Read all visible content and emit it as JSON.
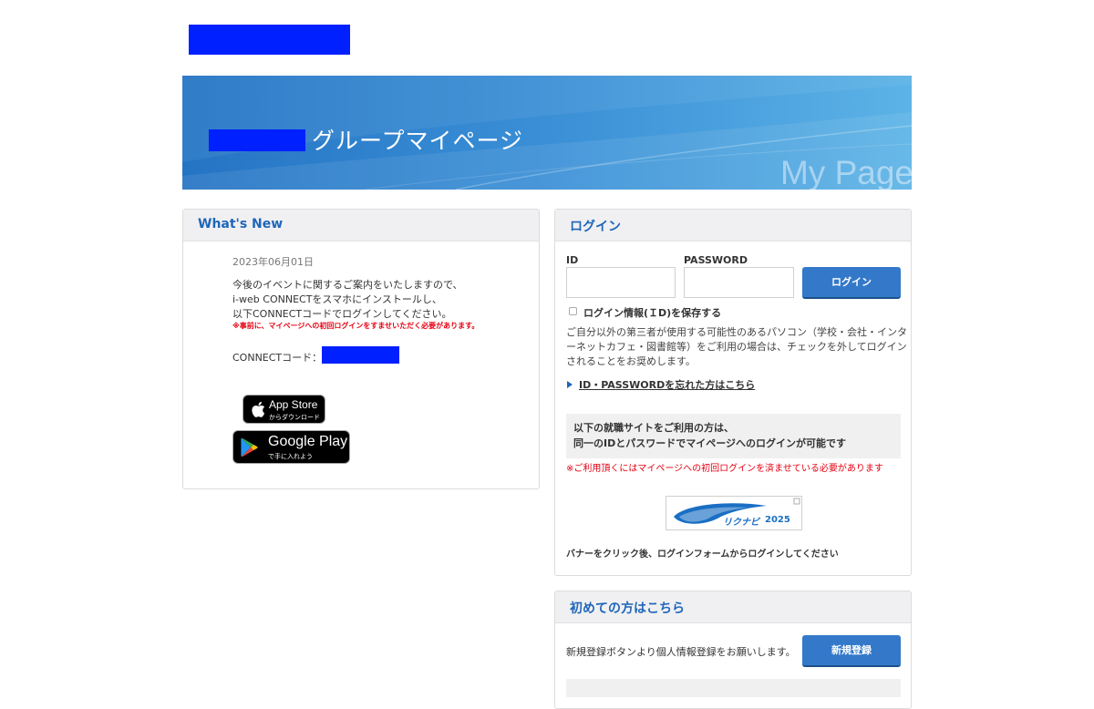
{
  "banner": {
    "title": "グループマイページ",
    "watermark": "My Page"
  },
  "whats_new": {
    "heading": "What's New",
    "date": "2023年06月01日",
    "lines": [
      "今後のイベントに関するご案内をいたしますので、",
      "i-web CONNECTをスマホにインストールし、",
      "以下CONNECTコードでログインしてください。"
    ],
    "warning": "※事前に、マイページへの初回ログインをすませいただく必要があります。",
    "connect_label": "CONNECTコード："
  },
  "app_store": {
    "main": "App Store",
    "sub": "からダウンロード",
    "icon": "apple-icon"
  },
  "google_play": {
    "main": "Google Play",
    "sub": "で手に入れよう",
    "icon": "google-play-icon"
  },
  "login": {
    "heading": "ログイン",
    "id_label": "ID",
    "id_value": "",
    "password_label": "PASSWORD",
    "password_value": "",
    "button": "ログイン",
    "remember_label": "ログイン情報(ＩD)を保存する",
    "remember_checked": false,
    "note_lines": [
      "ご自分以外の第三者が使用する可能性のあるパソコン（学校・会社・インタ",
      "ーネットカフェ・図書館等）をご利用の場合は、チェックを外してログイン",
      "されることをお奨めします。"
    ],
    "forgot_link": "ID・PASSWORDを忘れた方はこちら",
    "job_site_lines": [
      "以下の就職サイトをご利用の方は、",
      "同一のIDとパスワードでマイページへのログインが可能です"
    ],
    "job_site_note": "※ご利用頂くにはマイページへの初回ログインを済ませている必要があります",
    "rikunabi_label": "リクナビ",
    "rikunabi_year": "2025",
    "banner_note": "バナーをクリック後、ログインフォームからログインしてください"
  },
  "first_time": {
    "heading": "初めての方はこちら",
    "text": "新規登録ボタンより個人情報登録をお願いします。",
    "button": "新規登録"
  },
  "colors": {
    "accent": "#1f66b8",
    "button": "#3479c9",
    "warning": "#e60012",
    "redaction": "#0020ff"
  }
}
